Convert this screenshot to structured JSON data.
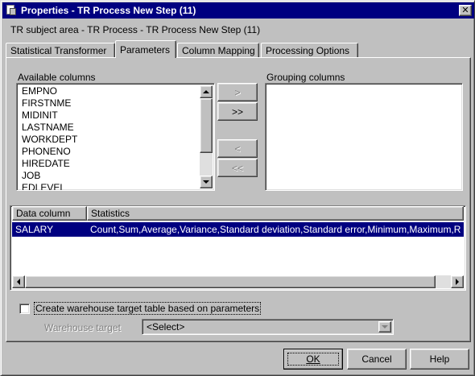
{
  "window": {
    "title": "Properties - TR Process New Step (11)"
  },
  "subject": "TR subject area - TR Process - TR Process New Step (11)",
  "tabs": [
    {
      "label": "Statistical Transformer"
    },
    {
      "label": "Parameters"
    },
    {
      "label": "Column Mapping"
    },
    {
      "label": "Processing Options"
    }
  ],
  "available": {
    "label": "Available columns",
    "items": [
      "EMPNO",
      "FIRSTNME",
      "MIDINIT",
      "LASTNAME",
      "WORKDEPT",
      "PHONENO",
      "HIREDATE",
      "JOB",
      "EDLEVEL"
    ]
  },
  "grouping": {
    "label": "Grouping columns"
  },
  "move_buttons": {
    "add": ">",
    "add_all": ">>",
    "remove": "<",
    "remove_all": "<<"
  },
  "grid": {
    "headers": [
      "Data column",
      "Statistics"
    ],
    "rows": [
      {
        "column": "SALARY",
        "stats": "Count,Sum,Average,Variance,Standard deviation,Standard error,Minimum,Maximum,R"
      }
    ]
  },
  "create_target": {
    "label": "Create warehouse target table based on parameters",
    "checked": false
  },
  "warehouse_target": {
    "label": "Warehouse target",
    "value": "<Select>"
  },
  "footer": {
    "ok": "OK",
    "cancel": "Cancel",
    "help": "Help"
  },
  "colors": {
    "title_bar": "#000080",
    "selection": "#000080",
    "face": "#c0c0c0"
  }
}
